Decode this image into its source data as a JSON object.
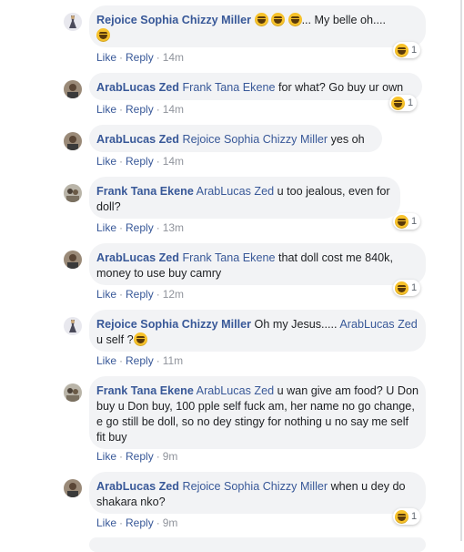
{
  "actions": {
    "like": "Like",
    "reply": "Reply",
    "separator": "·"
  },
  "colors": {
    "link": "#385898",
    "bubble": "#f2f3f5",
    "meta": "#90949c"
  },
  "comments": [
    {
      "author": "Rejoice Sophia Chizzy Miller",
      "tag": "",
      "text": "... My belle oh....",
      "time": "14m",
      "reactions": "1",
      "emoji_before": 3,
      "emoji_after": 1
    },
    {
      "author": "ArabLucas Zed",
      "tag": "Frank Tana Ekene",
      "text": " for what? Go buy ur own",
      "time": "14m",
      "reactions": "1"
    },
    {
      "author": "ArabLucas Zed",
      "tag": "Rejoice Sophia Chizzy Miller",
      "text": " yes oh",
      "time": "14m",
      "reactions": ""
    },
    {
      "author": "Frank Tana Ekene",
      "tag": "ArabLucas Zed",
      "text": " u too jealous, even for doll?",
      "time": "13m",
      "reactions": "1"
    },
    {
      "author": "ArabLucas Zed",
      "tag": "Frank Tana Ekene",
      "text": " that doll cost me 840k, money to use buy camry",
      "time": "12m",
      "reactions": "1"
    },
    {
      "author": "Rejoice Sophia Chizzy Miller",
      "tag": "ArabLucas Zed",
      "text_before": " Oh my Jesus..... ",
      "text": " u self ?",
      "time": "11m",
      "reactions": ""
    },
    {
      "author": "Frank Tana Ekene",
      "tag": "ArabLucas Zed",
      "text": " u wan give am food? U Don buy u Don buy, 100 pple self fuck am, her name no go change, e go still be doll, so no dey stingy for nothing u no say me self fit buy",
      "time": "9m",
      "reactions": ""
    },
    {
      "author": "ArabLucas Zed",
      "tag": "Rejoice Sophia Chizzy Miller",
      "text": " when u dey do shakara nko?",
      "time": "9m",
      "reactions": "1"
    }
  ]
}
